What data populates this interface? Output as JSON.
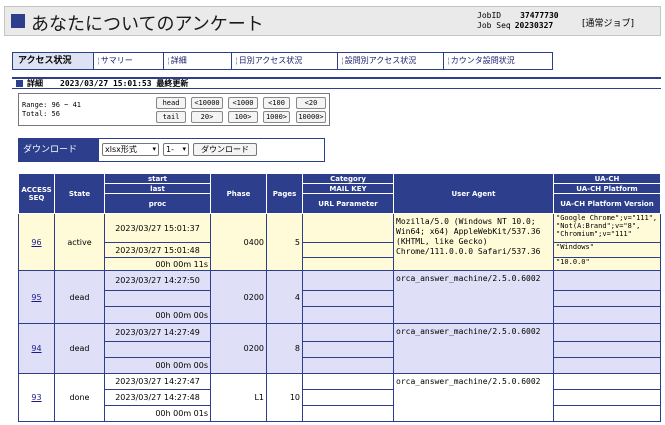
{
  "header": {
    "title": "あなたについてのアンケート",
    "job_id_label": "JobID",
    "job_id_value": "37477730",
    "job_seq_label": "Job Seq",
    "job_seq_value": "20230327",
    "job_type": "[通常ジョブ]"
  },
  "nav": {
    "current": "アクセス状況",
    "tabs": [
      {
        "label": "サマリー"
      },
      {
        "label": "詳細"
      },
      {
        "label": "日別アクセス状況"
      },
      {
        "label": "設問別アクセス状況"
      },
      {
        "label": "カウンタ設問状況"
      }
    ]
  },
  "section": {
    "label": "詳細",
    "updated": "2023/03/27 15:01:53 最終更新"
  },
  "range": {
    "range_text": "Range: 96 ~ 41",
    "total_text": "Total: 56",
    "buttons_top": [
      "head",
      "<10000",
      "<1000",
      "<100",
      "<20"
    ],
    "buttons_bottom": [
      "tail",
      "20>",
      "100>",
      "1000>",
      "10000>"
    ]
  },
  "download": {
    "label": "ダウンロード",
    "format": "xlsx形式",
    "page": "1-",
    "button": "ダウンロード"
  },
  "table": {
    "headers": {
      "access_seq": "ACCESS SEQ",
      "state": "State",
      "start": "start",
      "last": "last",
      "proc": "proc",
      "phase": "Phase",
      "pages": "Pages",
      "category": "Category",
      "mail_key": "MAIL KEY",
      "url_parameter": "URL Parameter",
      "user_agent": "User Agent",
      "ua_ch": "UA-CH",
      "ua_ch_platform": "UA-CH Platform",
      "ua_ch_platform_version": "UA-CH Platform Version"
    },
    "rows": [
      {
        "seq": "96",
        "state": "active",
        "start": "2023/03/27 15:01:37",
        "last": "2023/03/27 15:01:48",
        "proc": "00h 00m 11s",
        "phase": "0400",
        "pages": "5",
        "user_agent": "Mozilla/5.0 (Windows NT 10.0; Win64; x64) AppleWebKit/537.36 (KHTML, like Gecko) Chrome/111.0.0.0 Safari/537.36",
        "ua_ch": "\"Google Chrome\";v=\"111\", \"Not(A:Brand\";v=\"8\", \"Chromium\";v=\"111\"",
        "ua_ch_platform": "\"Windows\"",
        "ua_ch_platform_version": "\"10.0.0\""
      },
      {
        "seq": "95",
        "state": "dead",
        "start": "2023/03/27 14:27:50",
        "last": "",
        "proc": "00h 00m 00s",
        "phase": "0200",
        "pages": "4",
        "user_agent": "orca_answer_machine/2.5.0.6002",
        "ua_ch": "",
        "ua_ch_platform": "",
        "ua_ch_platform_version": ""
      },
      {
        "seq": "94",
        "state": "dead",
        "start": "2023/03/27 14:27:49",
        "last": "",
        "proc": "00h 00m 00s",
        "phase": "0200",
        "pages": "8",
        "user_agent": "orca_answer_machine/2.5.0.6002",
        "ua_ch": "",
        "ua_ch_platform": "",
        "ua_ch_platform_version": ""
      },
      {
        "seq": "93",
        "state": "done",
        "start": "2023/03/27 14:27:47",
        "last": "2023/03/27 14:27:48",
        "proc": "00h 00m 01s",
        "phase": "L1",
        "pages": "10",
        "user_agent": "orca_answer_machine/2.5.0.6002",
        "ua_ch": "",
        "ua_ch_platform": "",
        "ua_ch_platform_version": ""
      }
    ]
  },
  "colors": {
    "brand": "#2c3e8c",
    "active_row": "#fffbd8",
    "dead_row": "#dfdff7"
  }
}
